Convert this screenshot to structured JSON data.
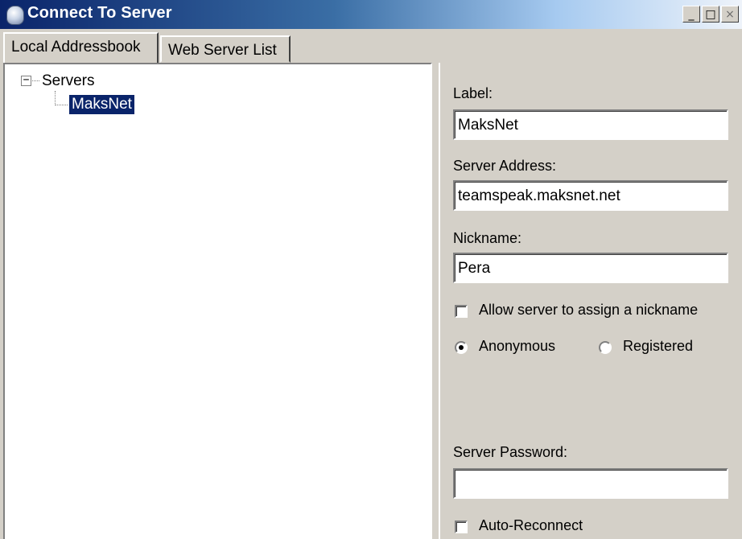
{
  "window": {
    "title": "Connect To Server",
    "controls": {
      "minimize": "_",
      "maximize": "□",
      "close": "×"
    },
    "icon": "teamspeak-headset-icon"
  },
  "tabs": [
    {
      "label": "Local Addressbook",
      "active": true
    },
    {
      "label": "Web Server List",
      "active": false
    }
  ],
  "tree": {
    "root": {
      "label": "Servers",
      "expander": "−"
    },
    "children": [
      {
        "label": "MaksNet",
        "selected": true
      }
    ]
  },
  "form": {
    "label": {
      "label": "Label:",
      "value": "MaksNet"
    },
    "server_address": {
      "label": "Server Address:",
      "value": "teamspeak.maksnet.net"
    },
    "nickname": {
      "label": "Nickname:",
      "value": "Pera"
    },
    "allow_assign_nickname": {
      "label": "Allow server to assign a nickname",
      "checked": false
    },
    "login_mode": {
      "options": [
        {
          "label": "Anonymous",
          "selected": true
        },
        {
          "label": "Registered",
          "selected": false
        }
      ]
    },
    "server_password": {
      "label": "Server Password:",
      "value": ""
    },
    "auto_reconnect": {
      "label": "Auto-Reconnect",
      "checked": false
    }
  },
  "colors": {
    "selection": "#0a246a",
    "face": "#d4d0c8",
    "titlebar_start": "#0a246a"
  }
}
